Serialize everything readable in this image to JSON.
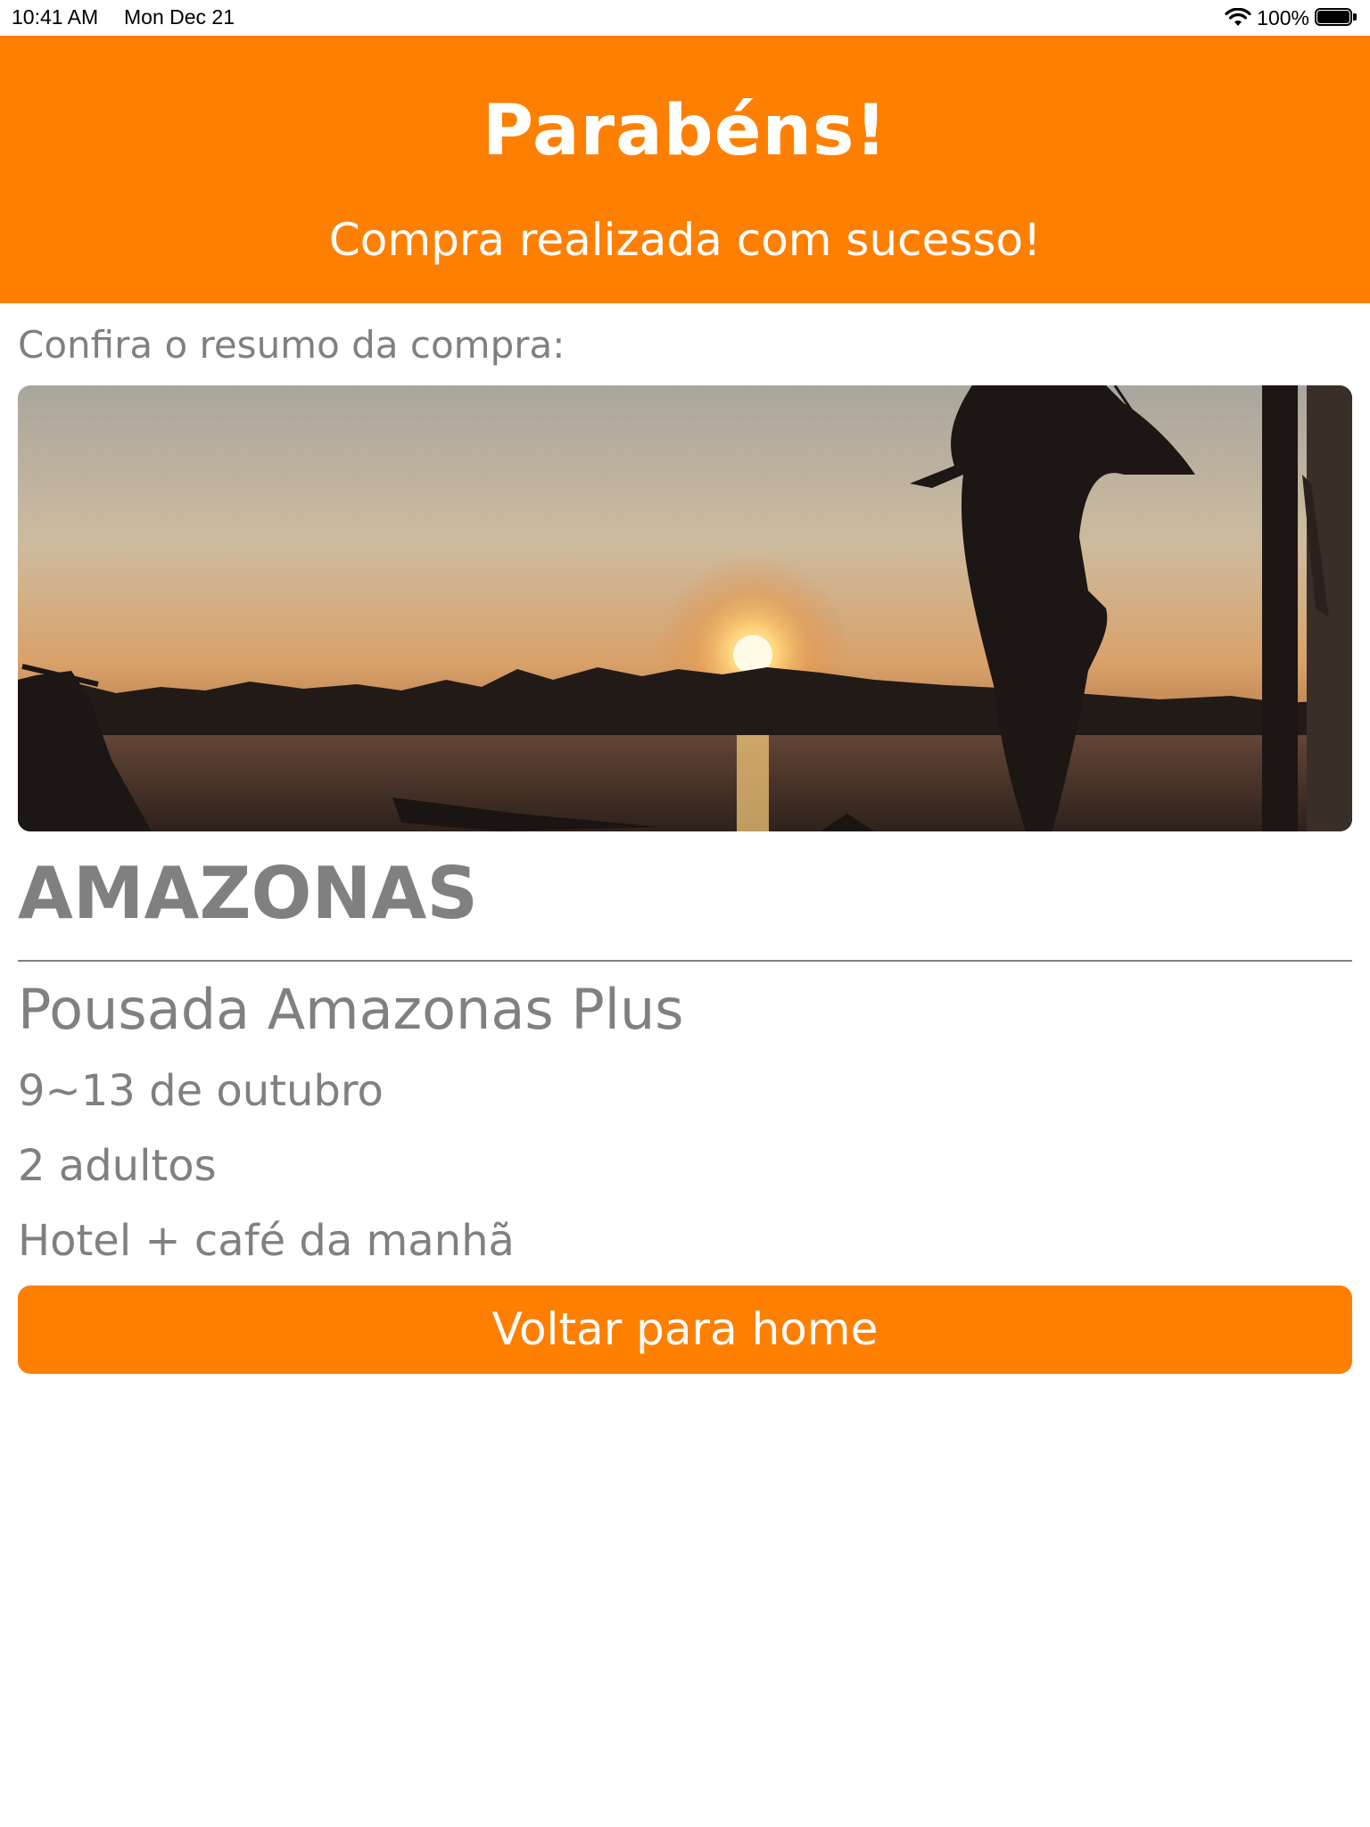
{
  "status_bar": {
    "time": "10:41 AM",
    "date": "Mon Dec 21",
    "battery": "100%",
    "icons": [
      "wifi-icon",
      "battery-icon"
    ]
  },
  "header": {
    "title": "Parabéns!",
    "subtitle": "Compra realizada com sucesso!",
    "background_color": "#FF7F00"
  },
  "summary": {
    "label": "Confira o resumo da compra:",
    "destination": "AMAZONAS",
    "hotel": "Pousada Amazonas Plus",
    "dates": "9~13 de outubro",
    "guests": "2 adultos",
    "package": "Hotel + café da manhã"
  },
  "actions": {
    "home_button_label": "Voltar para home",
    "button_color": "#FF7F00"
  },
  "colors": {
    "accent": "#FF7F00",
    "text_gray": "#808080"
  }
}
